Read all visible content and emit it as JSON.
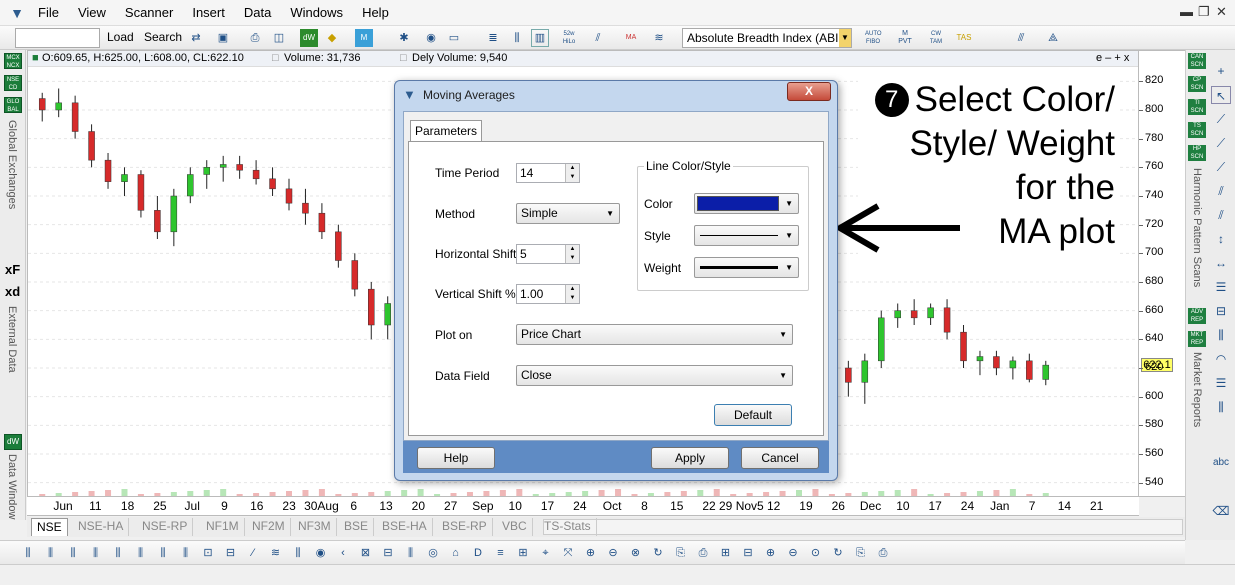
{
  "menubar": {
    "items": [
      "File",
      "View",
      "Scanner",
      "Insert",
      "Data",
      "Windows",
      "Help"
    ],
    "window_controls": [
      "▬",
      "❐",
      "✕"
    ]
  },
  "toolbar": {
    "load_label": "Load",
    "search_label": "Search",
    "indicator_combo": "Absolute Breadth Index (ABI",
    "icon_labels": [
      "52w HiLo",
      "MA",
      "AUTO FIBO",
      "M PVT",
      "CW TAM",
      "TAS"
    ]
  },
  "chart_info": {
    "ohlc": "O:609.65, H:625.00, L:608.00, CL:622.10",
    "volume": "Volume: 31,736",
    "dely_volume": "Dely Volume: 9,540",
    "window_buttons": "e – + x"
  },
  "left_panel": {
    "badges": [
      "MCX NCX",
      "NSE CD",
      "GLO BAL"
    ],
    "global_exchanges_label": "Global Exchanges",
    "external_data_label": "External Data",
    "data_window_label": "Data Window",
    "xf_label": "xF",
    "xd_label": "xd",
    "dw_label": "dW"
  },
  "right_panel": {
    "badges": [
      "CAN SCN",
      "CP SCN",
      "TI SCN",
      "TS SCN",
      "HP SCN"
    ],
    "report_badges": [
      "ADV REP",
      "MKT REP"
    ],
    "harmonic_label": "Harmonic Pattern Scans",
    "market_reports_label": "Market Reports",
    "abc_label": "abc"
  },
  "price_axis": {
    "ticks": [
      820,
      800,
      780,
      760,
      740,
      720,
      700,
      680,
      660,
      640,
      620,
      600,
      580,
      560,
      540
    ],
    "current_price": "622.1"
  },
  "date_axis": {
    "labels": [
      "Jun",
      "11",
      "18",
      "25",
      "Jul",
      "9",
      "16",
      "23",
      "30Aug",
      "6",
      "13",
      "20",
      "27",
      "Sep",
      "10",
      "17",
      "24",
      "Oct",
      "8",
      "15",
      "22",
      "29 Nov5",
      "12",
      "19",
      "26",
      "Dec",
      "10",
      "17",
      "24",
      "Jan",
      "7",
      "14",
      "21"
    ]
  },
  "tabs": [
    "NSE",
    "NSE-HA",
    "NSE-RP",
    "NF1M",
    "NF2M",
    "NF3M",
    "BSE",
    "BSE-HA",
    "BSE-RP",
    "VBC",
    "TS-Stats"
  ],
  "dialog": {
    "title": "Moving Averages",
    "close_label": "X",
    "tab_label": "Parameters",
    "time_period_label": "Time Period",
    "time_period_value": "14",
    "method_label": "Method",
    "method_value": "Simple",
    "horizontal_shift_label": "Horizontal Shift",
    "horizontal_shift_value": "5",
    "vertical_shift_label": "Vertical Shift %",
    "vertical_shift_value": "1.00",
    "plot_on_label": "Plot on",
    "plot_on_value": "Price Chart",
    "data_field_label": "Data Field",
    "data_field_value": "Close",
    "line_group_title": "Line Color/Style",
    "color_label": "Color",
    "color_value": "#0b1ea8",
    "style_label": "Style",
    "weight_label": "Weight",
    "default_button": "Default",
    "help_button": "Help",
    "apply_button": "Apply",
    "cancel_button": "Cancel"
  },
  "annotation": {
    "step_number": "7",
    "lines": [
      "Select Color/",
      "Style/ Weight",
      "for the",
      "MA plot"
    ]
  },
  "colors": {
    "bull_candle": "#2ec52e",
    "bear_candle": "#d62a2a",
    "chart_bg": "#ffffff",
    "dialog_frame": "#c4d7ee",
    "dialog_footer": "#5f8bc4"
  },
  "chart_data": {
    "type": "candlestick",
    "ylim": [
      530,
      830
    ],
    "candles": [
      [
        808,
        812,
        792,
        800
      ],
      [
        800,
        815,
        795,
        805
      ],
      [
        805,
        810,
        780,
        785
      ],
      [
        785,
        790,
        760,
        765
      ],
      [
        765,
        770,
        745,
        750
      ],
      [
        750,
        760,
        740,
        755
      ],
      [
        755,
        758,
        725,
        730
      ],
      [
        730,
        740,
        710,
        715
      ],
      [
        715,
        745,
        705,
        740
      ],
      [
        740,
        760,
        735,
        755
      ],
      [
        755,
        765,
        745,
        760
      ],
      [
        760,
        768,
        750,
        762
      ],
      [
        762,
        768,
        752,
        758
      ],
      [
        758,
        765,
        748,
        752
      ],
      [
        752,
        760,
        740,
        745
      ],
      [
        745,
        752,
        730,
        735
      ],
      [
        735,
        745,
        720,
        728
      ],
      [
        728,
        735,
        710,
        715
      ],
      [
        715,
        720,
        690,
        695
      ],
      [
        695,
        700,
        670,
        675
      ],
      [
        675,
        680,
        640,
        650
      ],
      [
        650,
        670,
        640,
        665
      ],
      [
        665,
        690,
        660,
        685
      ],
      [
        685,
        710,
        680,
        705
      ],
      [
        705,
        720,
        695,
        712
      ],
      [
        712,
        718,
        700,
        705
      ],
      [
        705,
        710,
        685,
        690
      ],
      [
        690,
        695,
        665,
        670
      ],
      [
        670,
        675,
        640,
        645
      ],
      [
        645,
        650,
        620,
        630
      ],
      [
        630,
        645,
        625,
        640
      ],
      [
        640,
        660,
        635,
        655
      ],
      [
        655,
        680,
        650,
        675
      ],
      [
        675,
        700,
        670,
        695
      ],
      [
        695,
        705,
        680,
        685
      ],
      [
        685,
        690,
        660,
        665
      ],
      [
        665,
        670,
        645,
        650
      ],
      [
        650,
        660,
        640,
        655
      ],
      [
        655,
        662,
        640,
        645
      ],
      [
        645,
        650,
        630,
        635
      ],
      [
        660,
        672,
        650,
        668
      ],
      [
        668,
        675,
        655,
        660
      ],
      [
        660,
        665,
        645,
        650
      ],
      [
        650,
        655,
        630,
        640
      ],
      [
        640,
        645,
        625,
        635
      ],
      [
        635,
        640,
        620,
        630
      ],
      [
        630,
        650,
        625,
        645
      ],
      [
        645,
        650,
        630,
        635
      ],
      [
        635,
        640,
        615,
        620
      ],
      [
        620,
        625,
        600,
        610
      ],
      [
        610,
        630,
        595,
        625
      ],
      [
        625,
        660,
        620,
        655
      ],
      [
        655,
        665,
        648,
        660
      ],
      [
        660,
        668,
        650,
        655
      ],
      [
        655,
        665,
        650,
        662
      ],
      [
        662,
        668,
        640,
        645
      ],
      [
        645,
        650,
        620,
        625
      ],
      [
        625,
        632,
        615,
        628
      ],
      [
        628,
        632,
        615,
        620
      ],
      [
        620,
        628,
        612,
        625
      ],
      [
        625,
        630,
        610,
        612
      ],
      [
        612,
        625,
        608,
        622
      ]
    ]
  }
}
